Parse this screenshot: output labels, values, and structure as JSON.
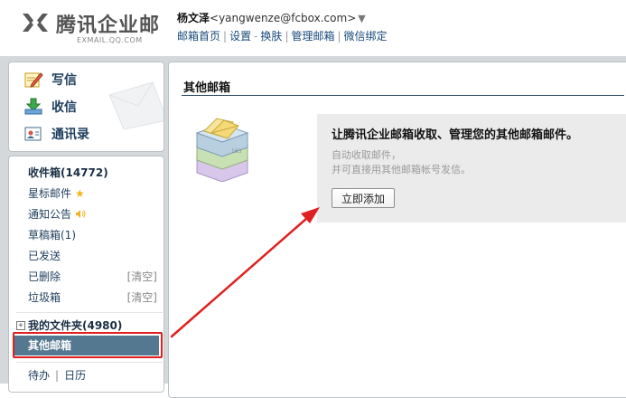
{
  "header": {
    "logo_text": "腾讯企业邮",
    "logo_sub": "EXMAIL.QQ.COM",
    "user_name": "杨文泽",
    "user_email": "<yangwenze@fcbox.com>",
    "dropdown_glyph": "▼",
    "links": [
      {
        "label": "邮箱首页"
      },
      {
        "label": "设置"
      },
      {
        "label": "换肤"
      },
      {
        "label": "管理邮箱"
      },
      {
        "label": "微信绑定"
      }
    ],
    "link_separator": "|",
    "link_separator_dash": "-"
  },
  "quick_actions": [
    {
      "label": "写信",
      "icon": "compose-icon"
    },
    {
      "label": "收信",
      "icon": "inbox-download-icon"
    },
    {
      "label": "通讯录",
      "icon": "contacts-icon"
    }
  ],
  "folders": {
    "inbox": "收件箱(14772)",
    "starred": "星标邮件",
    "notices": "通知公告",
    "drafts": "草稿箱(1)",
    "sent": "已发送",
    "deleted": "已删除",
    "spam": "垃圾箱",
    "clear_label": "[清空]",
    "my_folders": "我的文件夹(4980)",
    "other_mailboxes": "其他邮箱",
    "todo": "待办",
    "calendar": "日历",
    "bottom_sep": "|"
  },
  "content": {
    "title": "其他邮箱",
    "promo_title": "让腾讯企业邮箱收取、管理您的其他邮箱邮件。",
    "promo_desc1": "自动收取邮件，",
    "promo_desc2": "并可直接用其他邮箱帐号发信。",
    "add_button": "立即添加"
  },
  "colors": {
    "accent_selected": "#54788f",
    "annotation_red": "#e01f1f",
    "link_blue": "#1a4a7a",
    "panel_bg": "#d5d8db"
  }
}
